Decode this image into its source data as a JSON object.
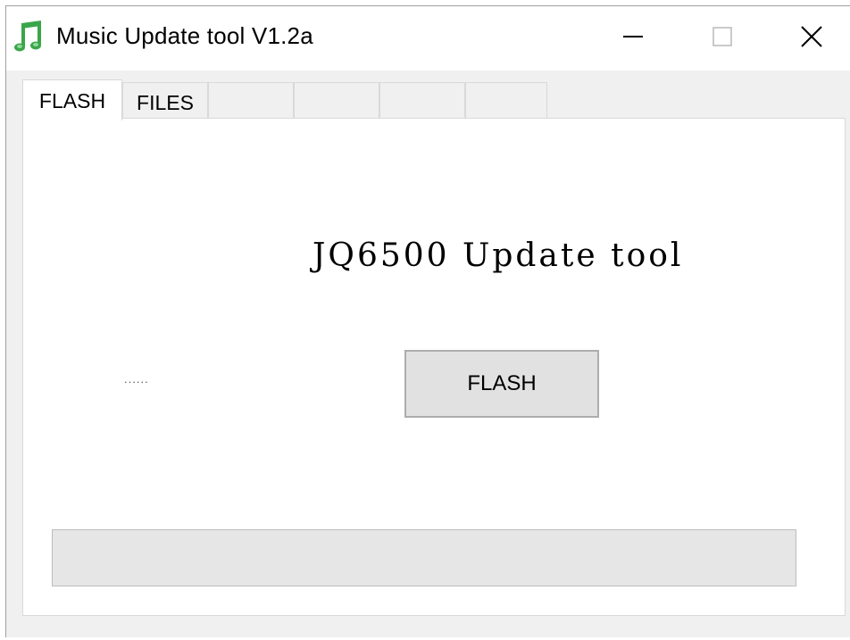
{
  "window": {
    "title": "Music Update tool V1.2a",
    "icon": "music-note-icon",
    "controls": [
      "minimize-icon",
      "maximize-icon",
      "close-icon"
    ]
  },
  "tabs": [
    {
      "label": "FLASH",
      "active": true
    },
    {
      "label": "FILES",
      "active": false
    },
    {
      "label": "",
      "active": false
    },
    {
      "label": "",
      "active": false
    },
    {
      "label": "",
      "active": false
    },
    {
      "label": "",
      "active": false
    }
  ],
  "main": {
    "heading": "JQ6500 Update tool",
    "status_text": "......",
    "flash_button_label": "FLASH",
    "progress": 0
  },
  "colors": {
    "icon_green": "#3aa64a",
    "button_bg": "#e1e1e1",
    "progress_fill": "#06b025"
  }
}
